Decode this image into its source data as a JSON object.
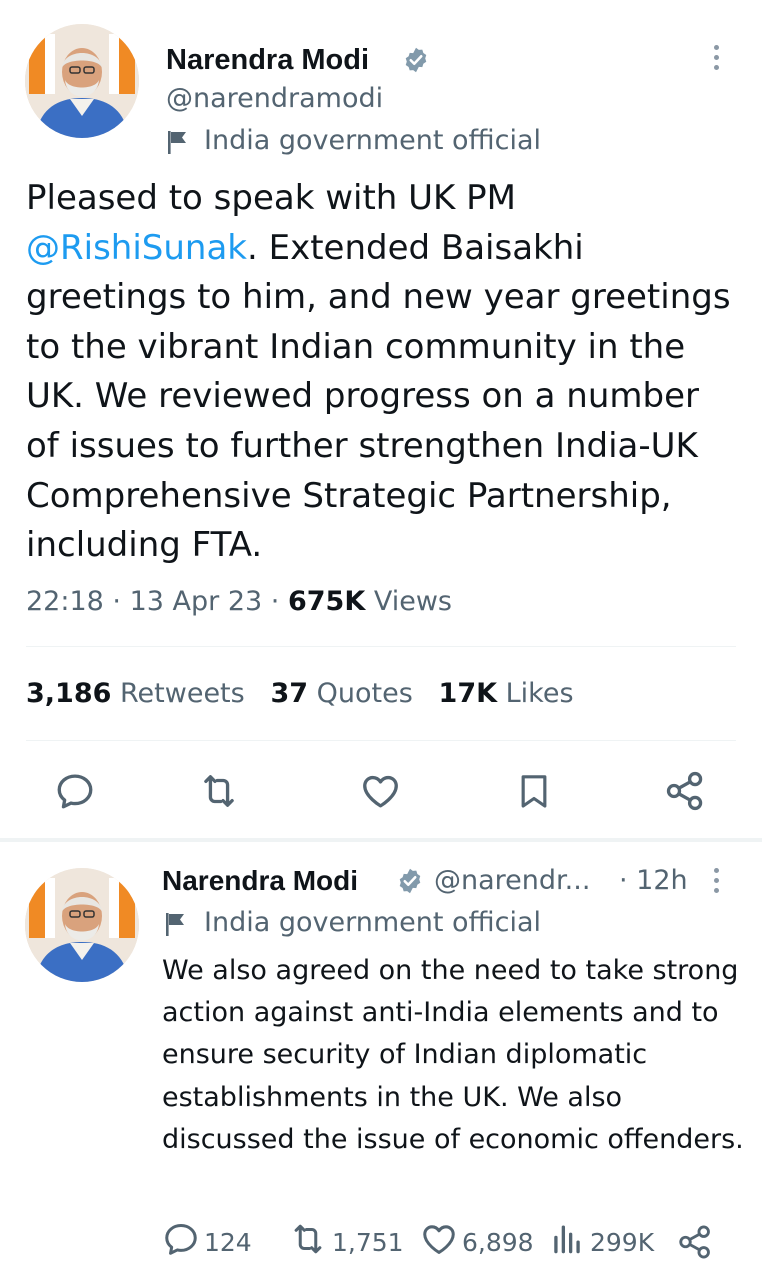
{
  "main_tweet": {
    "author": {
      "name": "Narendra Modi",
      "handle": "@narendramodi",
      "label": "India government official"
    },
    "text_parts": {
      "before": "Pleased to speak with UK PM ",
      "mention": "@RishiSunak",
      "after": ". Extended Baisakhi greetings to him, and new year greetings to the vibrant Indian community in the UK. We reviewed progress on a number of issues to further strengthen India-UK Comprehensive Strategic Partnership, including FTA."
    },
    "time": "22:18",
    "date": "13 Apr 23",
    "views_count": "675K",
    "views_label": "Views",
    "stats": {
      "retweets_count": "3,186",
      "retweets_label": "Retweets",
      "quotes_count": "37",
      "quotes_label": "Quotes",
      "likes_count": "17K",
      "likes_label": "Likes"
    }
  },
  "reply_tweet": {
    "author": {
      "name": "Narendra Modi",
      "handle": "@narendr...",
      "time": "· 12h",
      "label": "India government official"
    },
    "text": "We also agreed on the need to take strong action against anti-India elements and to ensure security of Indian diplomatic establishments in the UK. We also discussed the issue of economic offenders.",
    "metrics": {
      "replies": "124",
      "retweets": "1,751",
      "likes": "6,898",
      "views": "299K"
    }
  },
  "colors": {
    "accent": "#1d9bf0",
    "text_primary": "#0f1419",
    "text_secondary": "#536471",
    "divider": "#eff3f4"
  },
  "icons": [
    "verified-badge-icon",
    "flag-icon",
    "more-options-icon",
    "reply-icon",
    "retweet-icon",
    "like-icon",
    "bookmark-icon",
    "share-icon",
    "views-icon"
  ]
}
